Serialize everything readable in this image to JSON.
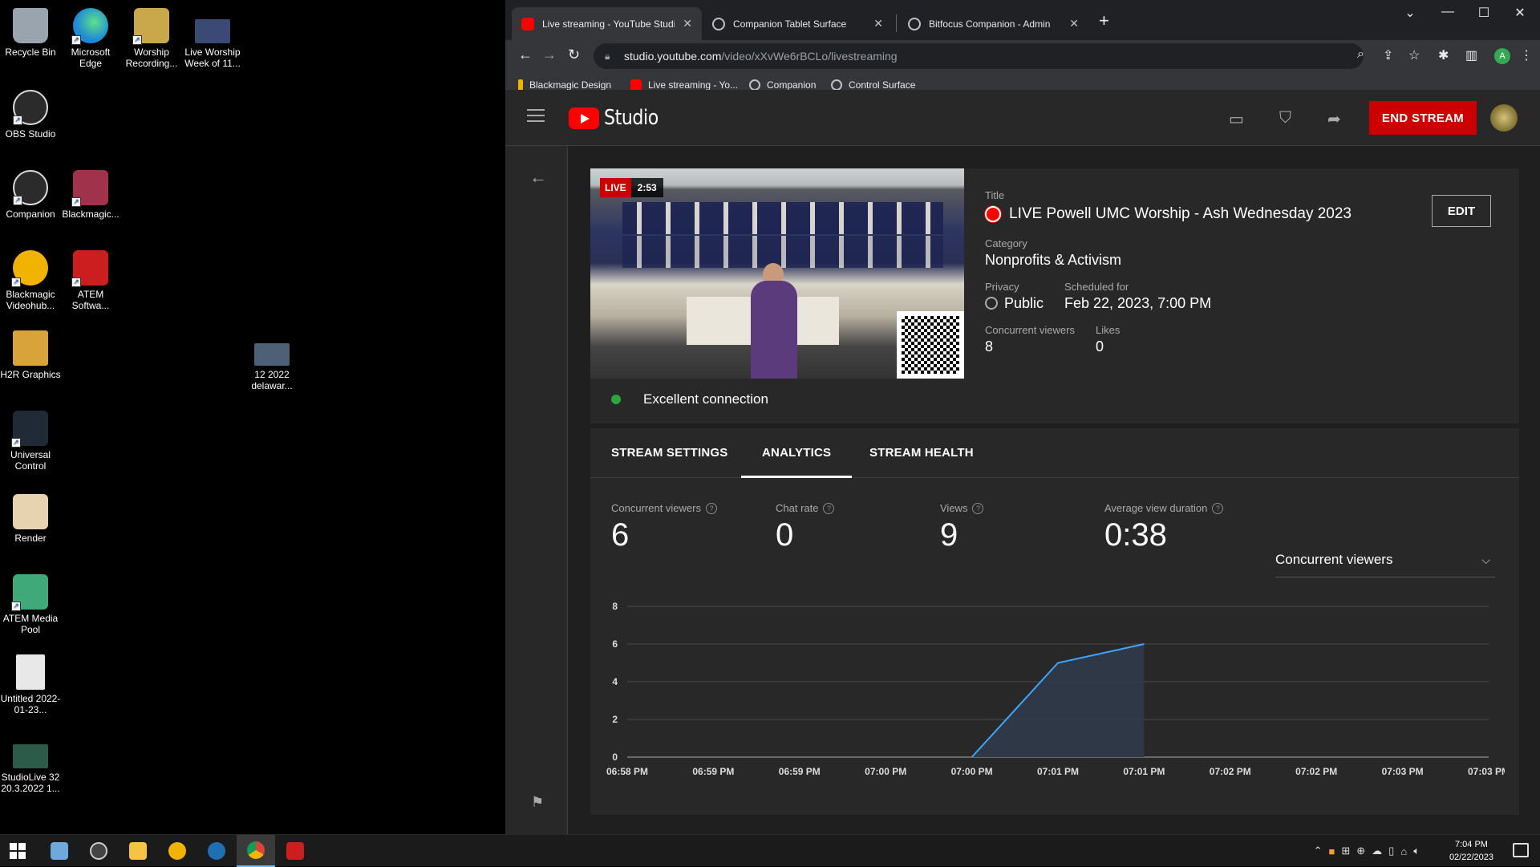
{
  "desktop": {
    "icons": [
      {
        "label": "Recycle Bin",
        "color": "#9aa4ae"
      },
      {
        "label": "Microsoft Edge",
        "color": "#1e8ad6"
      },
      {
        "label": "Worship Recording...",
        "color": "#c9a84c"
      },
      {
        "label": "Live Worship Week of 11...",
        "color": "#3b4a74"
      },
      {
        "label": "OBS Studio",
        "color": "#2b2b2b"
      },
      {
        "label": "Companion",
        "color": "#2b2b2b"
      },
      {
        "label": "Blackmagic...",
        "color": "#a0334b"
      },
      {
        "label": "Blackmagic Videohub...",
        "color": "#f0b400"
      },
      {
        "label": "ATEM Softwa...",
        "color": "#cc1e1e"
      },
      {
        "label": "H2R Graphics",
        "color": "#d8a33a"
      },
      {
        "label": "12 2022 delawar...",
        "color": "#4d6075"
      },
      {
        "label": "Universal Control",
        "color": "#1f6fb2"
      },
      {
        "label": "Render",
        "color": "#c9a4cf"
      },
      {
        "label": "ATEM Media Pool",
        "color": "#3fa97a"
      },
      {
        "label": "Untitled 2022-01-23...",
        "color": "#e8e8e8"
      },
      {
        "label": "StudioLive 32 20.3.2022 1...",
        "color": "#2d5b4a"
      }
    ]
  },
  "browser": {
    "tabs": [
      {
        "title": "Live streaming - YouTube Studio",
        "icon": "youtube-icon",
        "color": "#ff0000"
      },
      {
        "title": "Companion Tablet Surface",
        "icon": "globe-icon",
        "color": "#bdc1c6"
      },
      {
        "title": "Bitfocus Companion - Admin",
        "icon": "globe-icon",
        "color": "#bdc1c6"
      }
    ],
    "url_host": "studio.youtube.com",
    "url_path": "/video/xXvWe6rBCLo/livestreaming",
    "profile_initial": "A",
    "bookmarks": [
      {
        "label": "Blackmagic Design",
        "color": "#f0b400"
      },
      {
        "label": "Live streaming - Yo...",
        "color": "#ff0000"
      },
      {
        "label": "Companion",
        "color": "#bdc1c6"
      },
      {
        "label": "Control Surface",
        "color": "#bdc1c6"
      }
    ]
  },
  "studio": {
    "logo_text": "Studio",
    "end_stream_label": "END STREAM",
    "live_badge": "LIVE",
    "live_time": "2:53",
    "connection": "Excellent connection",
    "title_label": "Title",
    "title_value": "LIVE Powell UMC Worship - Ash Wednesday 2023",
    "edit_label": "EDIT",
    "category_label": "Category",
    "category_value": "Nonprofits & Activism",
    "privacy_label": "Privacy",
    "privacy_value": "Public",
    "scheduled_label": "Scheduled for",
    "scheduled_value": "Feb 22, 2023, 7:00 PM",
    "concurrent_label": "Concurrent viewers",
    "concurrent_value": "8",
    "likes_label": "Likes",
    "likes_value": "0",
    "tabs": [
      "STREAM SETTINGS",
      "ANALYTICS",
      "STREAM HEALTH"
    ],
    "active_tab": "ANALYTICS",
    "metrics": [
      {
        "label": "Concurrent viewers",
        "value": "6"
      },
      {
        "label": "Chat rate",
        "value": "0"
      },
      {
        "label": "Views",
        "value": "9"
      },
      {
        "label": "Average view duration",
        "value": "0:38"
      }
    ],
    "metric_select": "Concurrent viewers"
  },
  "chart_data": {
    "type": "area",
    "x": [
      "06:58 PM",
      "06:59 PM",
      "06:59 PM",
      "07:00 PM",
      "07:00 PM",
      "07:01 PM",
      "07:01 PM",
      "07:02 PM",
      "07:02 PM",
      "07:03 PM",
      "07:03 PM"
    ],
    "series": [
      {
        "values": [
          0,
          0,
          0,
          0,
          0,
          5,
          6
        ]
      }
    ],
    "yticks": [
      0,
      2,
      4,
      6,
      8
    ],
    "ylim": [
      0,
      8
    ],
    "grid": true,
    "line_color": "#3ea6ff",
    "fill_color": "#2f3a4a"
  },
  "taskbar": {
    "clock_time": "7:04 PM",
    "clock_date": "02/22/2023",
    "apps": [
      {
        "name": "taskbar-file-manager",
        "color": "#6fa8dc"
      },
      {
        "name": "taskbar-obs",
        "color": "#444"
      },
      {
        "name": "taskbar-explorer",
        "color": "#f5c542"
      },
      {
        "name": "taskbar-videohub",
        "color": "#f0b400"
      },
      {
        "name": "taskbar-universal-control",
        "color": "#1f6fb2"
      },
      {
        "name": "taskbar-chrome",
        "color": "#db4437"
      },
      {
        "name": "taskbar-atem",
        "color": "#cc1e1e"
      }
    ]
  }
}
